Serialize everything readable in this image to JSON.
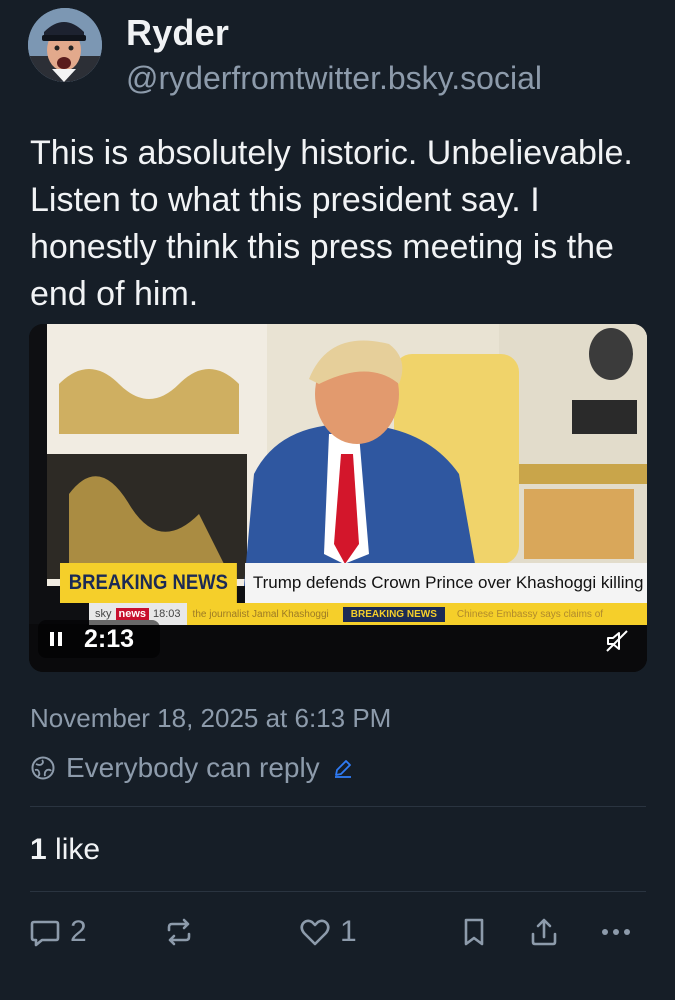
{
  "author": {
    "name": "Ryder",
    "handle": "@ryderfromtwitter.bsky.social"
  },
  "post": {
    "text": "This is absolutely historic. Unbelievable. Listen to what this president say. I honestly think this press meeting is the end of him.",
    "video": {
      "time": "2:13",
      "ticker_label": "BREAKING NEWS",
      "ticker_headline": "Trump defends Crown Prince over Khashoggi killing",
      "ticker_sky": "sky",
      "ticker_news": "news",
      "ticker_clock": "18:03",
      "ticker_sub": "the journalist Jamal Khashoggi",
      "ticker_label2": "BREAKING NEWS",
      "ticker_sub2": "Chinese Embassy says claims of"
    },
    "timestamp": "November 18, 2025 at 6:13 PM",
    "reply_setting": "Everybody can reply",
    "likes_count": "1",
    "likes_label": "like"
  },
  "actions": {
    "reply_count": "2",
    "like_count": "1"
  },
  "colors": {
    "background": "#161e27",
    "text": "#f1f3f5",
    "muted": "#8d9bab",
    "accent": "#2f7bf5"
  },
  "icons": [
    "avatar",
    "pause-icon",
    "mute-icon",
    "globe-icon",
    "edit-icon",
    "reply-icon",
    "repost-icon",
    "like-icon",
    "bookmark-icon",
    "share-icon",
    "more-icon"
  ]
}
